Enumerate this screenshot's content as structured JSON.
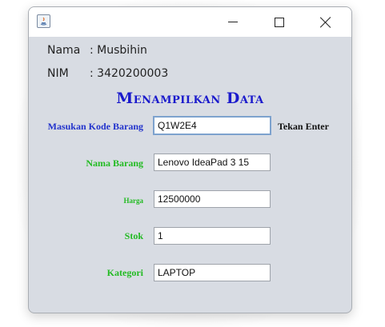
{
  "window": {
    "title": ""
  },
  "student": {
    "name_label": "Nama",
    "name_value": ": Musbihin",
    "nim_label": "NIM",
    "nim_value": ": 3420200003"
  },
  "heading": "Menampilkan Data",
  "form": {
    "kode": {
      "label": "Masukan Kode Barang",
      "value": "Q1W2E4",
      "hint": "Tekan Enter"
    },
    "nama": {
      "label": "Nama Barang",
      "value": "Lenovo IdeaPad 3 15"
    },
    "harga": {
      "label": "Harga",
      "value": "12500000"
    },
    "stok": {
      "label": "Stok",
      "value": "1"
    },
    "kategori": {
      "label": "Kategori",
      "value": "LAPTOP"
    }
  },
  "colors": {
    "heading": "#1a1acc",
    "kode_label": "#2233cc",
    "field_labels": "#22bb22"
  },
  "icons": [
    "java-app-icon",
    "minimize-icon",
    "maximize-icon",
    "close-icon"
  ]
}
